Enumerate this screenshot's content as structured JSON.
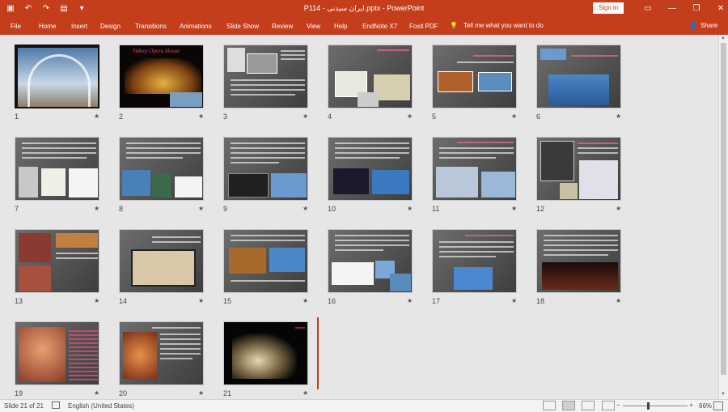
{
  "titlebar": {
    "document_title": "ایران سیدنی.pptx - PowerPoint",
    "file_prefix": "P114 - ",
    "signin_label": "Sign in",
    "qat_icons": [
      "save-icon",
      "undo-icon",
      "redo-icon",
      "start-slideshow-icon",
      "customize-qat-icon"
    ],
    "window_icons": [
      "ribbon-display-icon",
      "minimize-icon",
      "restore-icon",
      "close-icon"
    ]
  },
  "ribbon": {
    "tabs": [
      "File",
      "Home",
      "Insert",
      "Design",
      "Transitions",
      "Animations",
      "Slide Show",
      "Review",
      "View",
      "Help",
      "EndNote X7",
      "Foxit PDF"
    ],
    "tell_me": "Tell me what you want to do",
    "share": "Share"
  },
  "slides": [
    {
      "number": "1",
      "star": "★"
    },
    {
      "number": "2",
      "star": "★",
      "title": "Sidney Opera House"
    },
    {
      "number": "3",
      "star": "★"
    },
    {
      "number": "4",
      "star": "★"
    },
    {
      "number": "5",
      "star": "★"
    },
    {
      "number": "6",
      "star": "★"
    },
    {
      "number": "7",
      "star": "★"
    },
    {
      "number": "8",
      "star": "★"
    },
    {
      "number": "9",
      "star": "★"
    },
    {
      "number": "10",
      "star": "★"
    },
    {
      "number": "11",
      "star": "★"
    },
    {
      "number": "12",
      "star": "★"
    },
    {
      "number": "13",
      "star": "★"
    },
    {
      "number": "14",
      "star": "★"
    },
    {
      "number": "15",
      "star": "★"
    },
    {
      "number": "16",
      "star": "★"
    },
    {
      "number": "17",
      "star": "★"
    },
    {
      "number": "18",
      "star": "★"
    },
    {
      "number": "19",
      "star": "★"
    },
    {
      "number": "20",
      "star": "★"
    },
    {
      "number": "21",
      "star": "★"
    }
  ],
  "status": {
    "slide_info": "Slide 21 of 21",
    "language": "English (United States)",
    "zoom": "66%"
  },
  "colors": {
    "accent": "#c43e1c",
    "slide_bg": "#555555"
  }
}
